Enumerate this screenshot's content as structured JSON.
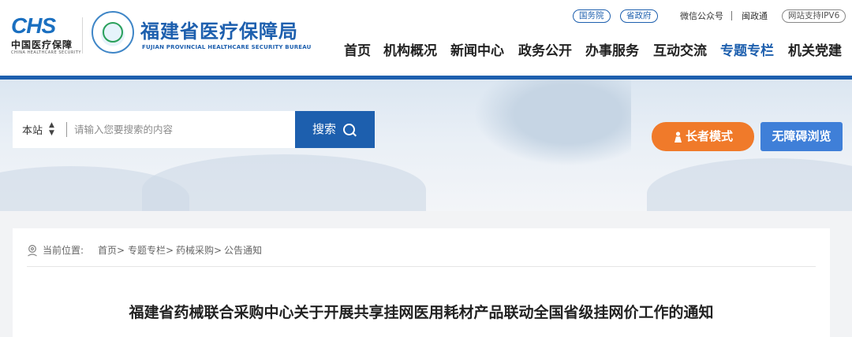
{
  "header": {
    "chs_mark": "CHS",
    "chs_cn": "中国医疗保障",
    "chs_en": "CHINA HEALTHCARE SECURITY",
    "bureau_cn": "福建省医疗保障局",
    "bureau_en": "FUJIAN PROVINCIAL HEALTHCARE SECURITY BUREAU",
    "top_links": {
      "state_council": "国务院",
      "provincial_gov": "省政府",
      "wechat": "微信公众号",
      "min_zheng_tong": "闽政通",
      "ipv6": "网站支持IPV6"
    },
    "nav": [
      "首页",
      "机构概况",
      "新闻中心",
      "政务公开",
      "办事服务",
      "互动交流",
      "专题专栏",
      "机关党建"
    ],
    "active_nav": "专题专栏"
  },
  "search": {
    "scope": "本站",
    "placeholder": "请输入您要搜索的内容",
    "button_label": "搜索"
  },
  "buttons": {
    "elder_mode": "长者模式",
    "accessible": "无障碍浏览"
  },
  "breadcrumb": {
    "label": "当前位置:",
    "items": [
      "首页>",
      "专题专栏>",
      "药械采购>",
      "公告通知"
    ]
  },
  "article": {
    "title": "福建省药械联合采购中心关于开展共享挂网医用耗材产品联动全国省级挂网价工作的通知"
  },
  "colors": {
    "brand_blue": "#1d5fae",
    "elder_orange": "#f07a2a",
    "accessible_blue": "#3f7fd8"
  }
}
